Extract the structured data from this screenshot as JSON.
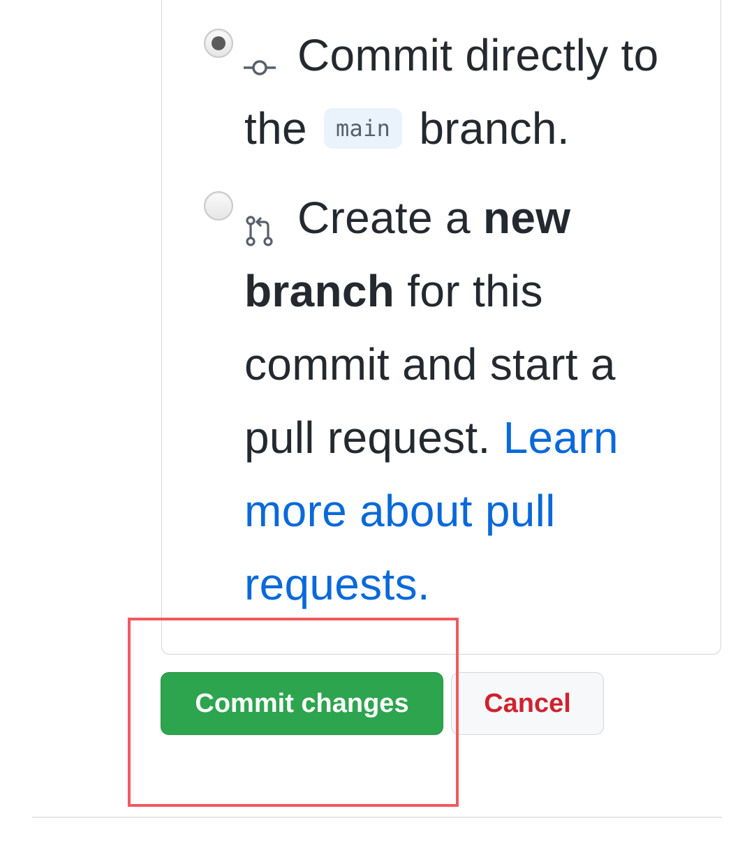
{
  "options": [
    {
      "checked": true,
      "icon": "commit-icon",
      "text_before": "Commit directly to the",
      "branch": "main",
      "text_after": "branch."
    },
    {
      "checked": false,
      "icon": "pull-request-icon",
      "text_before": "Create a",
      "bold": "new branch",
      "text_after": "for this commit and start a pull request.",
      "link": "Learn more about pull requests."
    }
  ],
  "buttons": {
    "commit_label": "Commit changes",
    "cancel_label": "Cancel"
  },
  "colors": {
    "commit_button": "#2da44e",
    "cancel_text": "#cf222e",
    "link": "#0969da",
    "highlight_box": "#ef5a5f"
  }
}
